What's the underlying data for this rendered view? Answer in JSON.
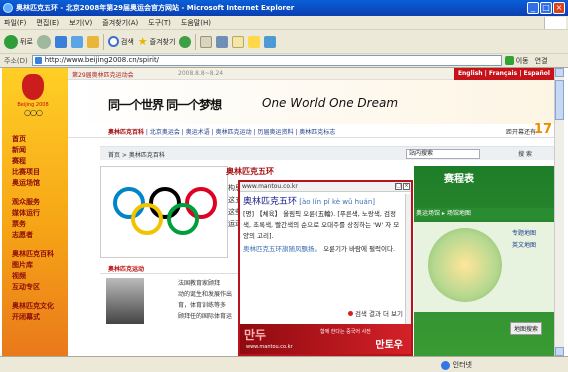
{
  "window": {
    "title": "奥林匹克五环 - 北京2008年第29届奥运会官方网站 - Microsoft Internet Explorer"
  },
  "menu": [
    "파일(F)",
    "편집(E)",
    "보기(V)",
    "즐겨찾기(A)",
    "도구(T)",
    "도움말(H)"
  ],
  "toolbar": {
    "back": "뒤로",
    "search": "검색",
    "favorites": "즐겨찾기"
  },
  "address": {
    "label": "주소(D)",
    "url": "http://www.beijing2008.cn/spirit/",
    "go": "이동",
    "links": "연결"
  },
  "site": {
    "games_name": "第29届奥林匹克运动会",
    "dates": "2008.8.8~8.24",
    "languages": "English | Français | Español",
    "slogan_cn": "同一个世界  同一个梦想",
    "slogan_en": "One World One Dream",
    "subnav": [
      "奥林匹克百科",
      "北京奥运会",
      "奥运术语",
      "奥林匹克运动",
      "历届奥运资料",
      "奥林匹克标志"
    ],
    "countdown_label": "距开幕还有",
    "countdown_value": "17",
    "breadcrumb": "首页  >  奥林匹克百科",
    "search_placeholder": "站内搜索",
    "search_button": "搜 索",
    "left_nav": [
      "首页",
      "新闻",
      "赛程",
      "比赛项目",
      "奥运场馆",
      "",
      "观众服务",
      "媒体运行",
      "票务",
      "志愿者",
      "",
      "奥林匹克百科",
      "图片库",
      "视频",
      "互动专区",
      "",
      "奥林匹克文化",
      "开闭幕式"
    ],
    "article_title": "奥林匹克五环",
    "article_side": [
      "构思",
      "这五",
      "这些",
      "运动"
    ],
    "movement": {
      "header": "奥林匹克运动",
      "lines": [
        "法国教育家顾拜",
        "动的诞生和发展作出",
        "育，体育训练等多",
        "顾拜任的国际体育运"
      ]
    },
    "right": {
      "header": "赛程表",
      "sub": "奥运场馆 ▸ 场馆地图",
      "links": [
        "专题地图",
        "英文地图"
      ],
      "map_search": "地图搜索"
    }
  },
  "popup": {
    "source": "www.mantou.co.kr",
    "word": "奥林匹克五环",
    "pinyin": "[ào lín pǐ kè wǔ huán]",
    "definition": "[명] 【체육】 올림픽 오륜(五輪). [푸른색, 노랑색, 검정색, 초록색, 빨간색의 순으로 오대주를 상징하는 'W' 자 모양의 고리].",
    "example_cn": "奥林匹克五环旗随风飘扬。",
    "example_ko": "오륜기가 바람에 펄럭이다.",
    "more": "검색 결과 더 보기",
    "footer_logo": "만두",
    "footer_url": "www.mantou.co.kr",
    "footer_ad": "함께 한다는 중국어 사전",
    "footer_brand": "만토우"
  },
  "status": {
    "zone": "인터넷"
  },
  "colors": {
    "titlebar": "#0a4fc8",
    "popup_border": "#b9121a",
    "site_red": "#a40d0d",
    "site_orange": "#f6a516"
  }
}
